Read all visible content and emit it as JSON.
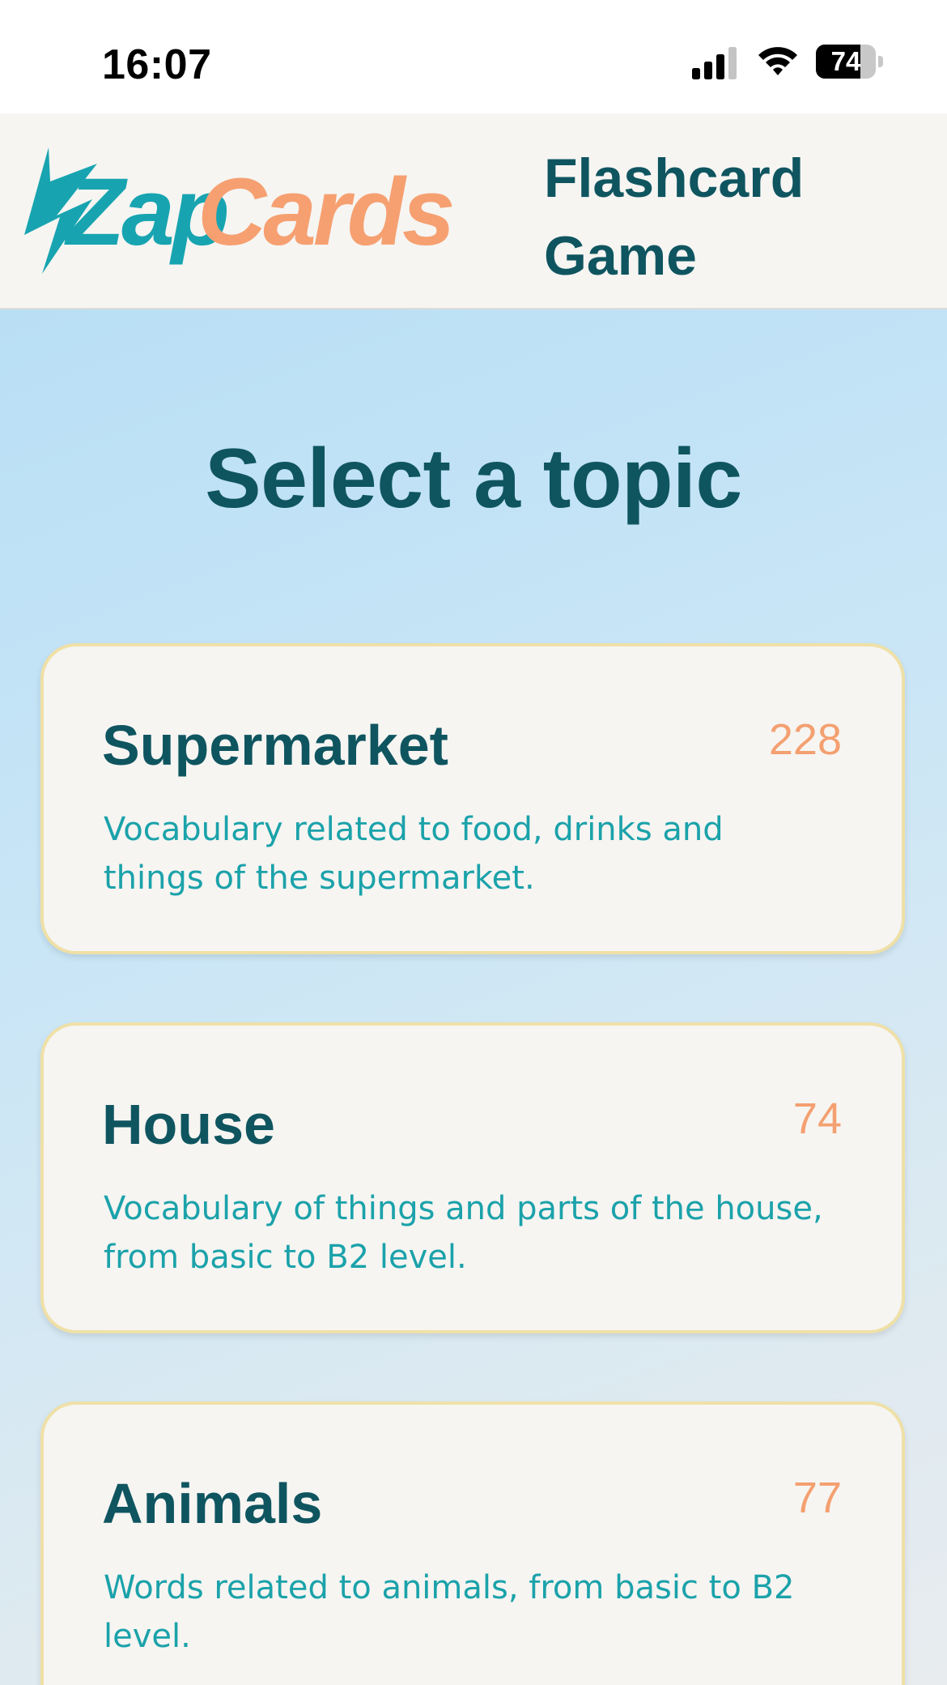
{
  "status_bar": {
    "time": "16:07",
    "battery": "74",
    "battery_level": 0.74
  },
  "header": {
    "logo_text_part1": "Zap",
    "logo_text_part2": "Cards",
    "title": "Flashcard Game",
    "colors": {
      "logo_teal": "#17a4b0",
      "logo_orange": "#f6a071",
      "title": "#0f5560"
    }
  },
  "main": {
    "heading": "Select a topic",
    "topics": [
      {
        "title": "Supermarket",
        "count": "228",
        "description": "Vocabulary related to food, drinks and things of the supermarket."
      },
      {
        "title": "House",
        "count": "74",
        "description": "Vocabulary of things and parts of the house, from basic to B2 level."
      },
      {
        "title": "Animals",
        "count": "77",
        "description": "Words related to animals, from basic to B2 level."
      }
    ]
  },
  "icons": [
    "signal-icon",
    "wifi-icon",
    "battery-icon",
    "lightning-bolt-icon"
  ],
  "colors": {
    "card_bg": "#f6f5f2",
    "card_border": "#efe0a7",
    "count": "#f4a071",
    "description": "#1ba2aa"
  }
}
